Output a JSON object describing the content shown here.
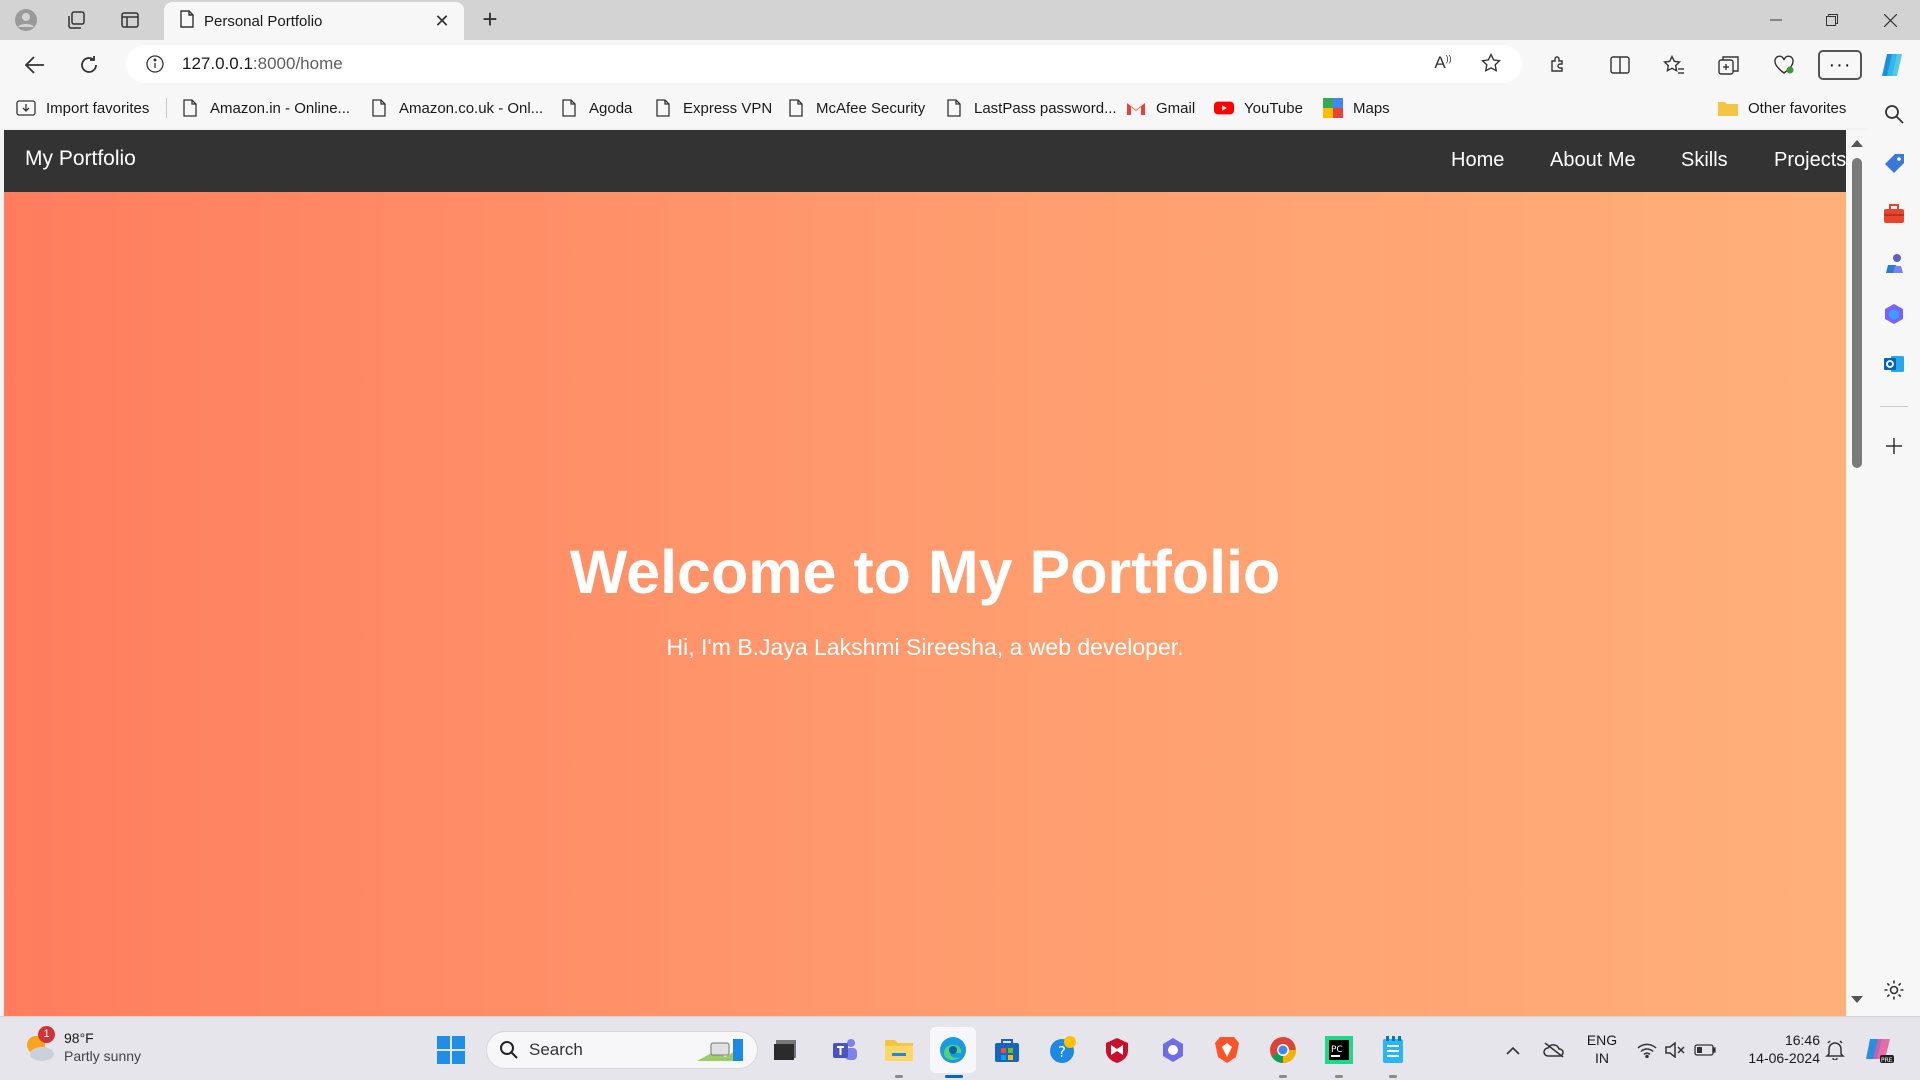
{
  "browser": {
    "tab_title": "Personal Portfolio",
    "url_host": "127.0.0.1",
    "url_path": ":8000/home",
    "favorites": [
      {
        "label": "Import favorites",
        "icon": "import-icon"
      },
      {
        "label": "Amazon.in - Online...",
        "icon": "page-icon"
      },
      {
        "label": "Amazon.co.uk - Onl...",
        "icon": "page-icon"
      },
      {
        "label": "Agoda",
        "icon": "page-icon"
      },
      {
        "label": "Express VPN",
        "icon": "page-icon"
      },
      {
        "label": "McAfee Security",
        "icon": "page-icon"
      },
      {
        "label": "LastPass password...",
        "icon": "page-icon"
      },
      {
        "label": "Gmail",
        "icon": "gmail-icon"
      },
      {
        "label": "YouTube",
        "icon": "youtube-icon"
      },
      {
        "label": "Maps",
        "icon": "maps-icon"
      }
    ],
    "other_favorites": "Other favorites"
  },
  "site": {
    "brand": "My Portfolio",
    "nav": [
      "Home",
      "About Me",
      "Skills",
      "Projects"
    ],
    "hero_title": "Welcome to My Portfolio",
    "hero_subtitle": "Hi, I'm B.Jaya Lakshmi Sireesha, a web developer."
  },
  "taskbar": {
    "weather_temp": "98°F",
    "weather_desc": "Partly sunny",
    "weather_badge": "1",
    "search_label": "Search",
    "lang_line1": "ENG",
    "lang_line2": "IN",
    "time": "16:46",
    "date": "14-06-2024"
  },
  "colors": {
    "site_nav_bg": "#333333",
    "hero_gradient_start": "#ff7d5e",
    "hero_gradient_end": "#ffb078",
    "taskbar_active": "#0067c0"
  }
}
